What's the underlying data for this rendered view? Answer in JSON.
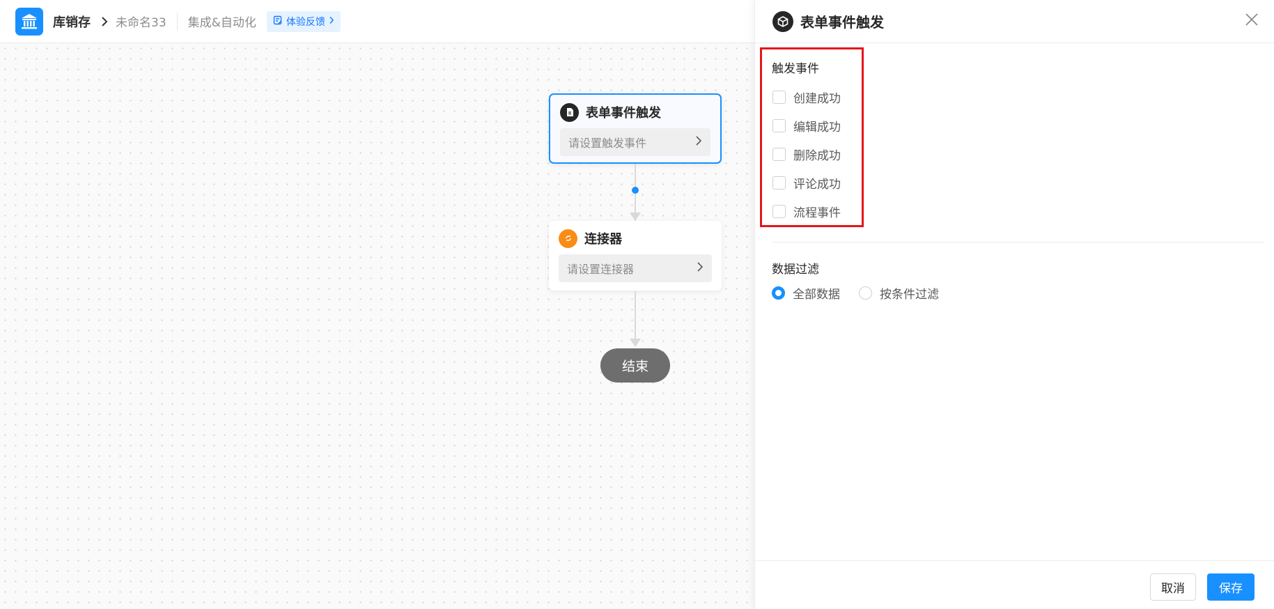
{
  "header": {
    "app_name": "库销存",
    "breadcrumb_item": "未命名33",
    "module": "集成&自动化",
    "feedback_label": "体验反馈"
  },
  "flow": {
    "trigger_node": {
      "title": "表单事件触发",
      "placeholder": "请设置触发事件"
    },
    "connector_node": {
      "title": "连接器",
      "placeholder": "请设置连接器"
    },
    "end_label": "结束"
  },
  "panel": {
    "title": "表单事件触发",
    "trigger_section_label": "触发事件",
    "trigger_events": [
      {
        "label": "创建成功",
        "checked": false
      },
      {
        "label": "编辑成功",
        "checked": false
      },
      {
        "label": "删除成功",
        "checked": false
      },
      {
        "label": "评论成功",
        "checked": false
      },
      {
        "label": "流程事件",
        "checked": false
      }
    ],
    "filter_section_label": "数据过滤",
    "filter_options": [
      {
        "label": "全部数据",
        "checked": true
      },
      {
        "label": "按条件过滤",
        "checked": false
      }
    ],
    "cancel_label": "取消",
    "save_label": "保存"
  },
  "colors": {
    "accent": "#1890ff",
    "highlight_box": "#e3161a",
    "connector_icon": "#fa8c16",
    "end_node": "#6e6e6e"
  },
  "icons": {
    "app_logo": "bank-icon",
    "feedback": "feedback-icon",
    "trigger_node": "document-icon",
    "connector_node": "connector-icon",
    "panel_header": "cube-icon",
    "close": "close-icon"
  }
}
